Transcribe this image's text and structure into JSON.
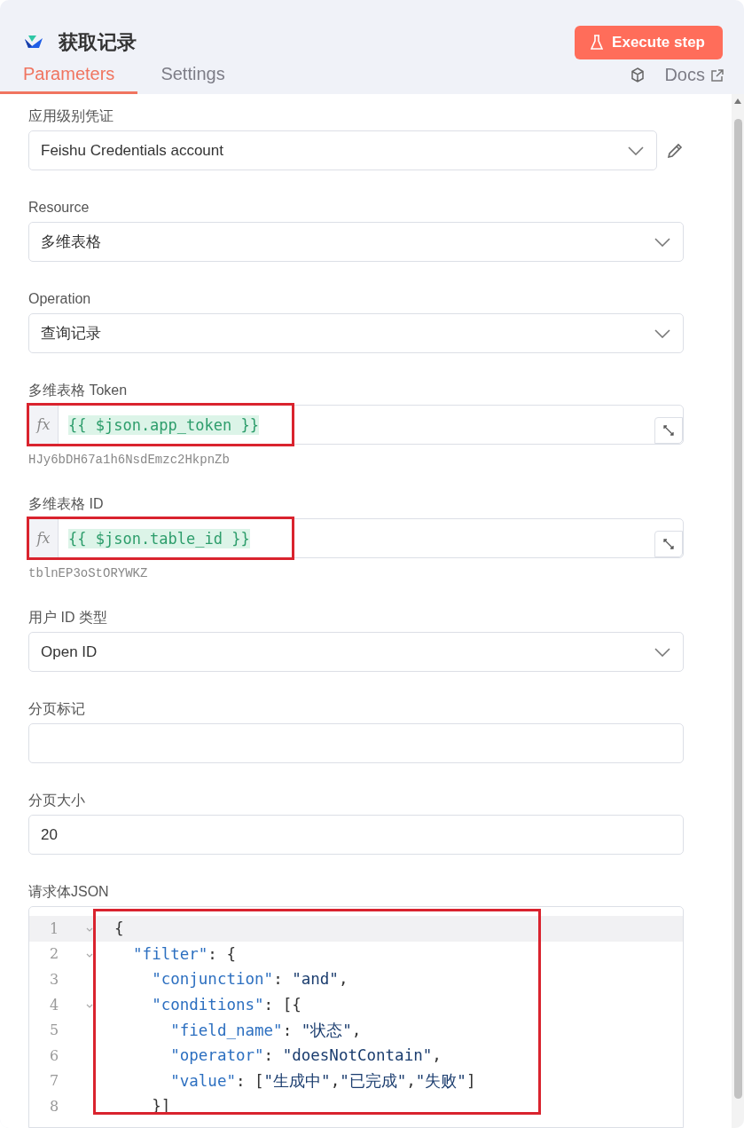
{
  "header": {
    "title": "获取记录",
    "execute_button": "Execute step"
  },
  "tabs": [
    {
      "label": "Parameters",
      "selected": true
    },
    {
      "label": "Settings",
      "selected": false
    }
  ],
  "docs_link": "Docs",
  "fields": [
    {
      "kind": "select",
      "label": "应用级别凭证",
      "value": "Feishu Credentials account",
      "editable": true
    },
    {
      "kind": "select",
      "label": "Resource",
      "value": "多维表格",
      "editable": false
    },
    {
      "kind": "select",
      "label": "Operation",
      "value": "查询记录",
      "editable": false
    },
    {
      "kind": "expression",
      "label": "多维表格 Token",
      "prefix": "fx",
      "value": "{{ $json.app_token }}",
      "hint": "HJy6bDH67a1h6NsdEmzc2HkpnZb",
      "highlighted": true
    },
    {
      "kind": "expression",
      "label": "多维表格 ID",
      "prefix": "fx",
      "value": "{{ $json.table_id }}",
      "hint": "tblnEP3oStORYWKZ",
      "highlighted": true
    },
    {
      "kind": "select",
      "label": "用户 ID 类型",
      "value": "Open ID",
      "editable": false
    },
    {
      "kind": "text",
      "label": "分页标记"
    },
    {
      "kind": "text",
      "label": "分页大小",
      "value": "20"
    }
  ],
  "code_editor": {
    "label": "请求体JSON",
    "highlighted": true,
    "lines": [
      {
        "number": "1",
        "foldable": true,
        "active": true,
        "tokens": [
          {
            "kind": "punct",
            "text": "{"
          }
        ]
      },
      {
        "number": "2",
        "foldable": true,
        "active": false,
        "tokens": [
          {
            "kind": "key",
            "text": "  \"filter\""
          },
          {
            "kind": "punct",
            "text": ": {"
          }
        ]
      },
      {
        "number": "3",
        "foldable": false,
        "active": false,
        "tokens": [
          {
            "kind": "key",
            "text": "    \"conjunction\""
          },
          {
            "kind": "punct",
            "text": ":"
          },
          {
            "kind": "string",
            "text": " \"and\""
          },
          {
            "kind": "punct",
            "text": ","
          }
        ]
      },
      {
        "number": "4",
        "foldable": true,
        "active": false,
        "tokens": [
          {
            "kind": "key",
            "text": "    \"conditions\""
          },
          {
            "kind": "punct",
            "text": ": [{"
          }
        ]
      },
      {
        "number": "5",
        "foldable": false,
        "active": false,
        "tokens": [
          {
            "kind": "key",
            "text": "      \"field_name\""
          },
          {
            "kind": "punct",
            "text": ":"
          },
          {
            "kind": "string",
            "text": " \"状态\""
          },
          {
            "kind": "punct",
            "text": ","
          }
        ]
      },
      {
        "number": "6",
        "foldable": false,
        "active": false,
        "tokens": [
          {
            "kind": "key",
            "text": "      \"operator\""
          },
          {
            "kind": "punct",
            "text": ":"
          },
          {
            "kind": "string",
            "text": " \"doesNotContain\""
          },
          {
            "kind": "punct",
            "text": ","
          }
        ]
      },
      {
        "number": "7",
        "foldable": false,
        "active": false,
        "tokens": [
          {
            "kind": "key",
            "text": "      \"value\""
          },
          {
            "kind": "punct",
            "text": ": ["
          },
          {
            "kind": "string",
            "text": "\"生成中\""
          },
          {
            "kind": "punct",
            "text": ","
          },
          {
            "kind": "string",
            "text": "\"已完成\""
          },
          {
            "kind": "punct",
            "text": ","
          },
          {
            "kind": "string",
            "text": "\"失败\""
          },
          {
            "kind": "punct",
            "text": "]"
          }
        ]
      },
      {
        "number": "8",
        "foldable": false,
        "active": false,
        "tokens": [
          {
            "kind": "punct",
            "text": "    }]"
          }
        ]
      }
    ]
  }
}
